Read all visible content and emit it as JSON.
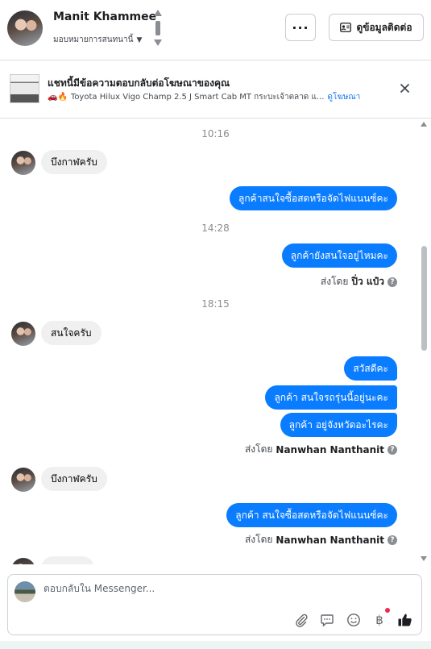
{
  "header": {
    "name": "Manit Khammee",
    "assign_label": "มอบหมายการสนทนานี้",
    "more_label": "···",
    "contact_label": "ดูข้อมูลติดต่อ"
  },
  "ad_banner": {
    "title": "แชทนี้มีข้อความตอบกลับต่อโฆษณาของคุณ",
    "emoji": "🚗🔥",
    "ad_text": "Toyota Hilux Vigo Champ 2.5 J Smart Cab MT กระบะเจ้าตลาด แ...",
    "link_label": "ดูโฆษณา",
    "close_label": "✕"
  },
  "messages": {
    "t1": "10:16",
    "in1": "บึงกาฬครับ",
    "out1": "ลูกค้าสนใจซื้อสดหรือจัดไฟแนนซ์คะ",
    "t2": "14:28",
    "out2": "ลูกค้ายังสนใจอยู่ไหมคะ",
    "sent_by_prefix": "ส่งโดย",
    "sender1": "ปิ่ว แป๋ว",
    "t3": "18:15",
    "in2": "สนใจครับ",
    "out3": "สวัสดีคะ",
    "out4": "ลูกค้า สนใจรถรุ่นนี้อยู่นะคะ",
    "out5": "ลูกค้า อยู่จังหวัดอะไรคะ",
    "sender2": "Nanwhan Nanthanit",
    "in3": "บึงกาฬครับ",
    "out6": "ลูกค้า สนใจซื้อสดหรือจัดไฟแนนซ์คะ",
    "sender3": "Nanwhan Nanthanit"
  },
  "composer": {
    "placeholder": "ตอบกลับใน Messenger..."
  },
  "icons": {
    "attach": "paperclip-icon",
    "saved_replies": "chat-bubble-icon",
    "emoji": "smiley-icon",
    "payment": "baht-icon",
    "like": "thumbs-up-icon"
  },
  "colors": {
    "outgoing_bubble": "#0a7cff",
    "incoming_bubble": "#f0f0f0",
    "link": "#1877f2"
  }
}
